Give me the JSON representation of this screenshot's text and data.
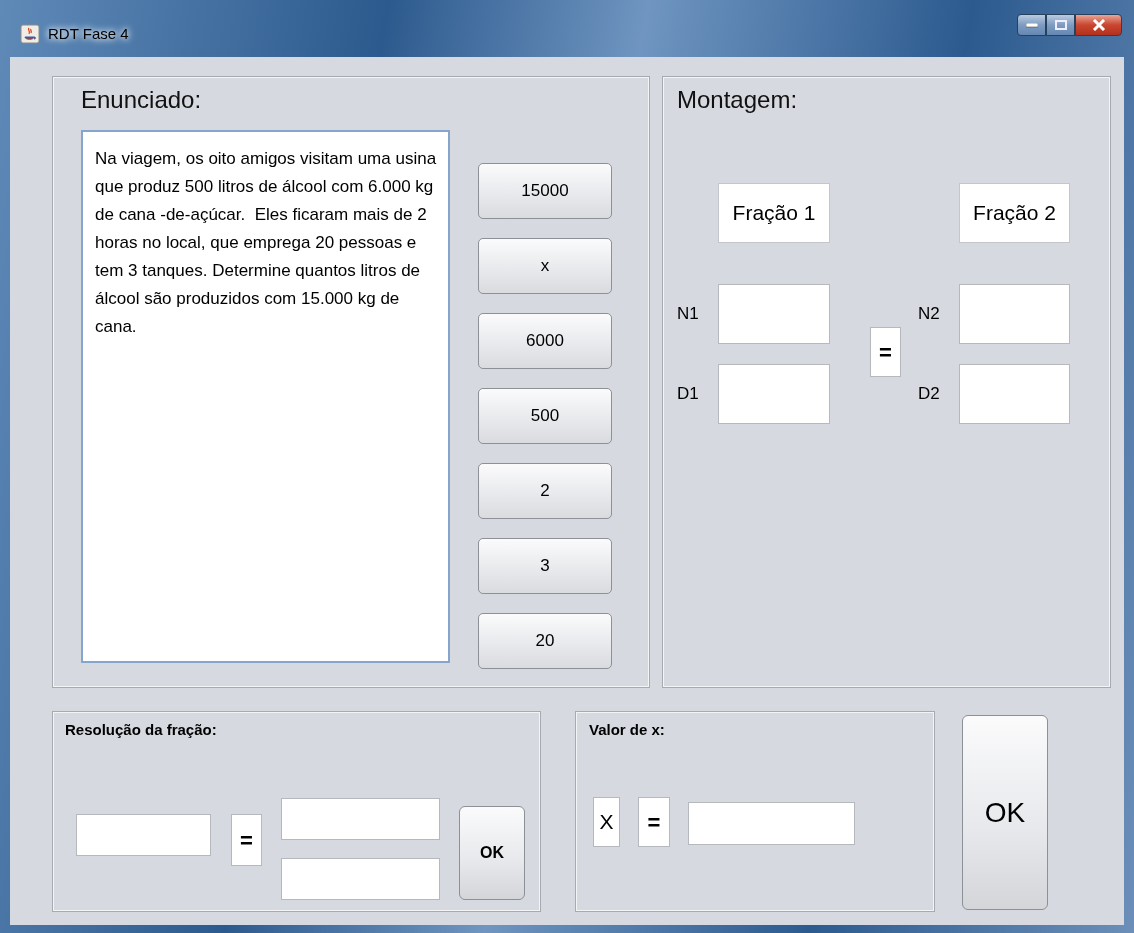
{
  "window": {
    "title": "RDT Fase 4"
  },
  "enunciado": {
    "title": "Enunciado:",
    "text": "Na viagem, os oito amigos visitam uma usina que produz 500 litros de álcool com 6.000 kg de cana -de-açúcar.  Eles ficaram mais de 2 horas no local, que emprega 20 pessoas e tem 3 tanques. Determine quantos litros de álcool são produzidos com 15.000 kg de cana."
  },
  "option_buttons": [
    "15000",
    "x",
    "6000",
    "500",
    "2",
    "3",
    "20"
  ],
  "montagem": {
    "title": "Montagem:",
    "fraction_labels": [
      "Fração 1",
      "Fração 2"
    ],
    "row_labels": [
      "N1",
      "D1",
      "N2",
      "D2"
    ],
    "equals": "="
  },
  "resolucao": {
    "title": "Resolução da fração:",
    "equals": "=",
    "button": "OK"
  },
  "valor_x": {
    "title": "Valor de x:",
    "x_label": "X",
    "equals": "="
  },
  "ok_button": "OK"
}
